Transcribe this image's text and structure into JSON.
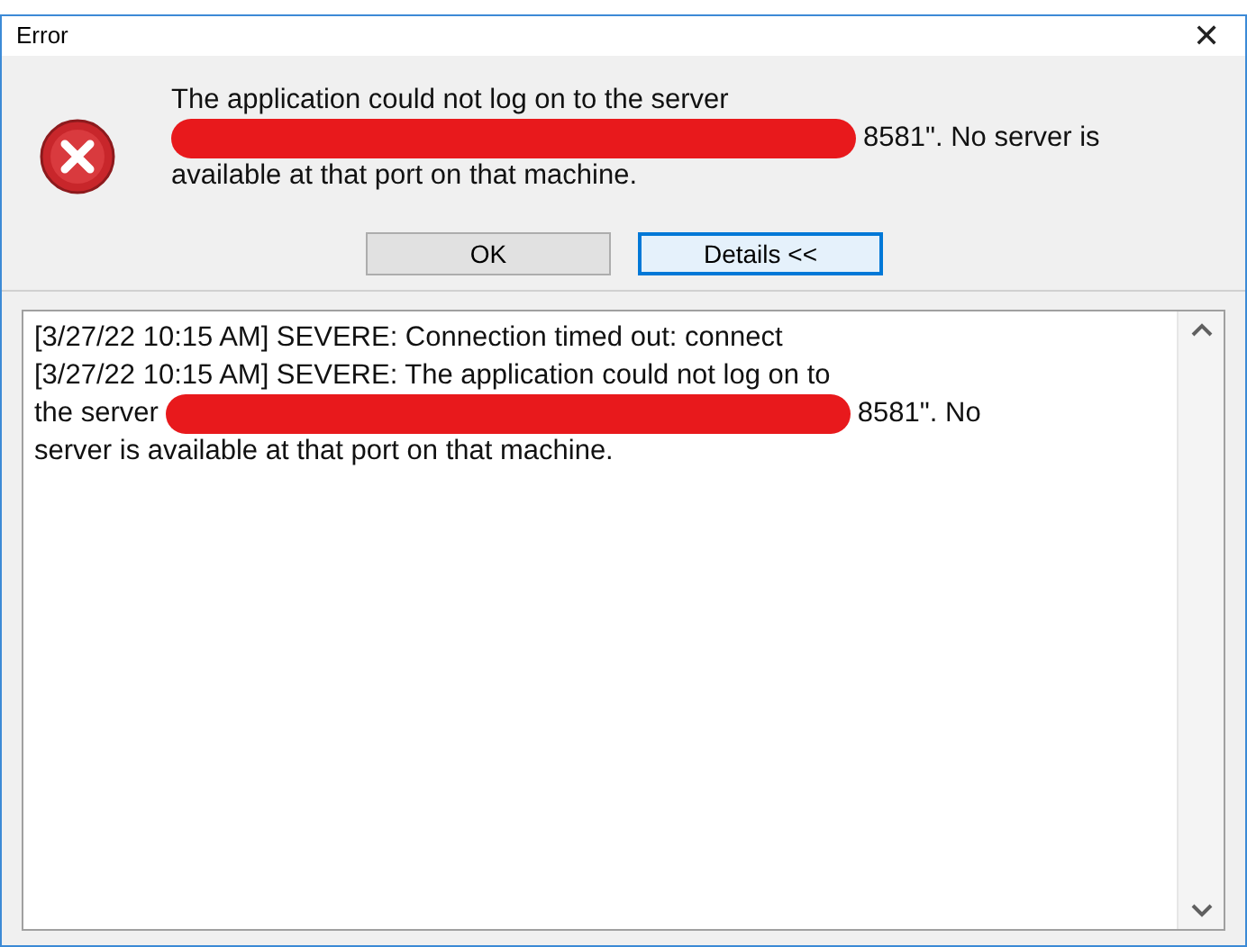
{
  "window": {
    "title": "Error",
    "close": "✕"
  },
  "message": [
    [
      {
        "kind": "text",
        "text": "The application could not log on to the server"
      }
    ],
    [
      {
        "kind": "redaction"
      },
      {
        "kind": "text",
        "text": "8581\". No server is"
      }
    ],
    [
      {
        "kind": "text",
        "text": "available at that port on that machine."
      }
    ]
  ],
  "buttons": [
    {
      "label": "OK",
      "focused": false
    },
    {
      "label": "Details <<",
      "focused": true
    }
  ],
  "log": [
    [
      {
        "kind": "text",
        "text": "[3/27/22 10:15 AM] SEVERE: Connection timed out: connect"
      }
    ],
    [
      {
        "kind": "text",
        "text": "[3/27/22 10:15 AM] SEVERE: The application could not log on to"
      }
    ],
    [
      {
        "kind": "text",
        "text": "the server"
      },
      {
        "kind": "redaction"
      },
      {
        "kind": "text",
        "text": "8581\". No"
      }
    ],
    [
      {
        "kind": "text",
        "text": "server is available at that port on that machine."
      }
    ]
  ]
}
